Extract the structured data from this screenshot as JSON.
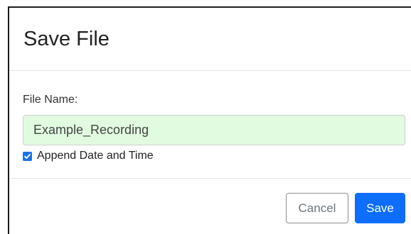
{
  "dialog": {
    "title": "Save File",
    "file_name_label": "File Name:",
    "file_name_value": "Example_Recording",
    "append_checkbox": {
      "label": "Append Date and Time",
      "checked": true
    },
    "buttons": {
      "cancel_label": "Cancel",
      "save_label": "Save"
    }
  },
  "colors": {
    "input_background": "#e1fbe0",
    "primary": "#0d6efd",
    "checkbox": "#1a73e8"
  }
}
